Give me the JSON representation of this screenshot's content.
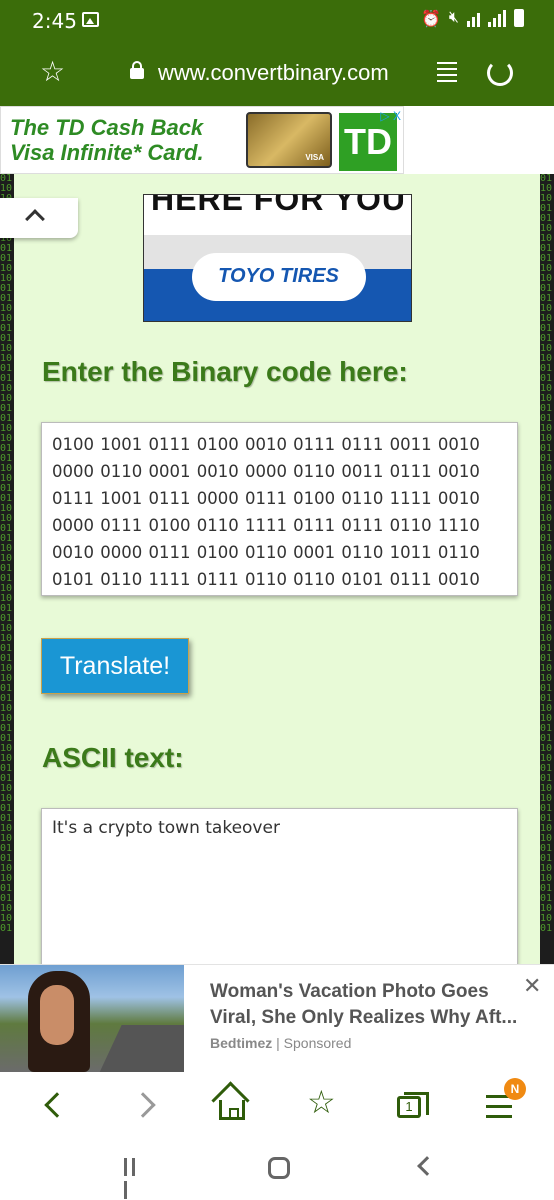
{
  "status": {
    "time": "2:45"
  },
  "browser": {
    "url": "www.convertbinary.com"
  },
  "top_ad": {
    "headline_line1": "The TD Cash Back",
    "headline_line2": "Visa Infinite* Card.",
    "card_brand": "VISA",
    "logo": "TD",
    "ad_choice": "▷ X"
  },
  "banner_ad": {
    "cut_text": "HERE FOR YOU",
    "brand": "TOYO TIRES"
  },
  "converter": {
    "binary_heading": "Enter the Binary code here:",
    "binary_value": "0100 1001 0111 0100 0010 0111 0111 0011 0010 0000 0110 0001 0010 0000 0110 0011 0111 0010 0111 1001 0111 0000 0111 0100 0110 1111 0010 0000 0111 0100 0110 1111 0111 0111 0110 1110 0010 0000 0111 0100 0110 0001 0110 1011 0110 0101 0110 1111 0111 0110 0110 0101 0111 0010",
    "translate_label": "Translate!",
    "ascii_heading": "ASCII text:",
    "ascii_value": "It's a crypto town takeover"
  },
  "bottom_ad": {
    "title": "Woman's Vacation Photo Goes Viral, She Only Realizes Why Aft...",
    "source": "Bedtimez",
    "sponsored": "Sponsored"
  },
  "bottom_nav": {
    "tab_count": "1",
    "menu_badge": "N"
  },
  "binary_rain": "01101001011010010110100101101001011010010110100101101001011010010110100101101001011010010110100101101001011010010110100101101001011010010110100101101001"
}
